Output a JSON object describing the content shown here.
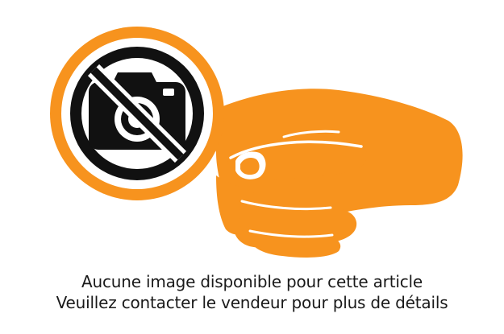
{
  "placeholder": {
    "line1": "Aucune image disponible pour cette article",
    "line2": "Veuillez contacter le vendeur pour plus de détails"
  },
  "colors": {
    "accent": "#f7931e",
    "ink": "#111111",
    "background": "#ffffff"
  },
  "icons": {
    "hand": "hand-holding-card-icon",
    "no_photo": "no-camera-icon"
  }
}
